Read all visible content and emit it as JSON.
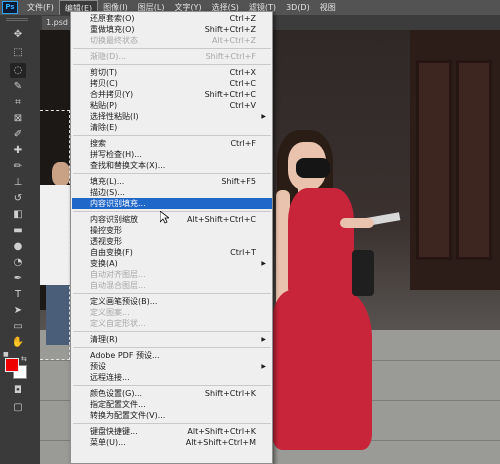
{
  "app": {
    "logo_text": "Ps"
  },
  "menubar": {
    "items": [
      {
        "label": "文件(F)",
        "key": "file",
        "active": false
      },
      {
        "label": "编辑(E)",
        "key": "edit",
        "active": true
      },
      {
        "label": "图像(I)",
        "key": "image",
        "active": false
      },
      {
        "label": "图层(L)",
        "key": "layer",
        "active": false
      },
      {
        "label": "文字(Y)",
        "key": "type",
        "active": false
      },
      {
        "label": "选择(S)",
        "key": "select",
        "active": false
      },
      {
        "label": "滤镜(T)",
        "key": "filter",
        "active": false
      },
      {
        "label": "3D(D)",
        "key": "3d",
        "active": false
      },
      {
        "label": "视图",
        "key": "view",
        "active": false
      }
    ]
  },
  "document_tab": {
    "label": "1.psd"
  },
  "tools": [
    {
      "name": "move-tool-icon",
      "glyph": "✥"
    },
    {
      "name": "marquee-tool-icon",
      "glyph": "⬚"
    },
    {
      "name": "lasso-tool-icon",
      "glyph": "◌",
      "selected": true
    },
    {
      "name": "quick-select-tool-icon",
      "glyph": "✎"
    },
    {
      "name": "crop-tool-icon",
      "glyph": "⌗"
    },
    {
      "name": "frame-tool-icon",
      "glyph": "⊠"
    },
    {
      "name": "eyedropper-tool-icon",
      "glyph": "✐"
    },
    {
      "name": "healing-brush-tool-icon",
      "glyph": "✚"
    },
    {
      "name": "brush-tool-icon",
      "glyph": "✏"
    },
    {
      "name": "clone-stamp-tool-icon",
      "glyph": "⊥"
    },
    {
      "name": "history-brush-tool-icon",
      "glyph": "↺"
    },
    {
      "name": "eraser-tool-icon",
      "glyph": "◧"
    },
    {
      "name": "gradient-tool-icon",
      "glyph": "▬"
    },
    {
      "name": "blur-tool-icon",
      "glyph": "●"
    },
    {
      "name": "dodge-tool-icon",
      "glyph": "◔"
    },
    {
      "name": "pen-tool-icon",
      "glyph": "✒"
    },
    {
      "name": "type-tool-icon",
      "glyph": "T"
    },
    {
      "name": "path-select-tool-icon",
      "glyph": "➤"
    },
    {
      "name": "shape-tool-icon",
      "glyph": "▭"
    },
    {
      "name": "hand-tool-icon",
      "glyph": "✋"
    },
    {
      "name": "zoom-tool-icon",
      "glyph": "⚲"
    },
    {
      "name": "more-tools-icon",
      "glyph": "•••"
    }
  ],
  "colors": {
    "foreground": "#ef0000",
    "background": "#ffffff",
    "highlight": "#1f67c8",
    "menu_bg": "#efefef"
  },
  "menu": {
    "items": [
      {
        "label": "还原套索(O)",
        "shortcut": "Ctrl+Z"
      },
      {
        "label": "重做填充(O)",
        "shortcut": "Shift+Ctrl+Z"
      },
      {
        "label": "切换最终状态",
        "shortcut": "Alt+Ctrl+Z",
        "disabled": true
      },
      {
        "sep": true
      },
      {
        "label": "渐隐(D)...",
        "shortcut": "Shift+Ctrl+F",
        "disabled": true
      },
      {
        "sep": true
      },
      {
        "label": "剪切(T)",
        "shortcut": "Ctrl+X"
      },
      {
        "label": "拷贝(C)",
        "shortcut": "Ctrl+C"
      },
      {
        "label": "合并拷贝(Y)",
        "shortcut": "Shift+Ctrl+C"
      },
      {
        "label": "粘贴(P)",
        "shortcut": "Ctrl+V"
      },
      {
        "label": "选择性粘贴(I)",
        "submenu": true
      },
      {
        "label": "清除(E)"
      },
      {
        "sep": true
      },
      {
        "label": "搜索",
        "shortcut": "Ctrl+F"
      },
      {
        "label": "拼写检查(H)..."
      },
      {
        "label": "查找和替换文本(X)..."
      },
      {
        "sep": true
      },
      {
        "label": "填充(L)...",
        "shortcut": "Shift+F5"
      },
      {
        "label": "描边(S)..."
      },
      {
        "label": "内容识别填充...",
        "highlighted": true
      },
      {
        "sep": true
      },
      {
        "label": "内容识别缩放",
        "shortcut": "Alt+Shift+Ctrl+C"
      },
      {
        "label": "操控变形"
      },
      {
        "label": "透视变形"
      },
      {
        "label": "自由变换(F)",
        "shortcut": "Ctrl+T"
      },
      {
        "label": "变换(A)",
        "submenu": true
      },
      {
        "label": "自动对齐图层...",
        "disabled": true
      },
      {
        "label": "自动混合图层...",
        "disabled": true
      },
      {
        "sep": true
      },
      {
        "label": "定义画笔预设(B)..."
      },
      {
        "label": "定义图案...",
        "disabled": true
      },
      {
        "label": "定义自定形状...",
        "disabled": true
      },
      {
        "sep": true
      },
      {
        "label": "清理(R)",
        "submenu": true
      },
      {
        "sep": true
      },
      {
        "label": "Adobe PDF 预设..."
      },
      {
        "label": "预设",
        "submenu": true
      },
      {
        "label": "远程连接..."
      },
      {
        "sep": true
      },
      {
        "label": "颜色设置(G)...",
        "shortcut": "Shift+Ctrl+K"
      },
      {
        "label": "指定配置文件..."
      },
      {
        "label": "转换为配置文件(V)..."
      },
      {
        "sep": true
      },
      {
        "label": "键盘快捷键...",
        "shortcut": "Alt+Shift+Ctrl+K"
      },
      {
        "label": "菜单(U)...",
        "shortcut": "Alt+Shift+Ctrl+M"
      }
    ]
  }
}
